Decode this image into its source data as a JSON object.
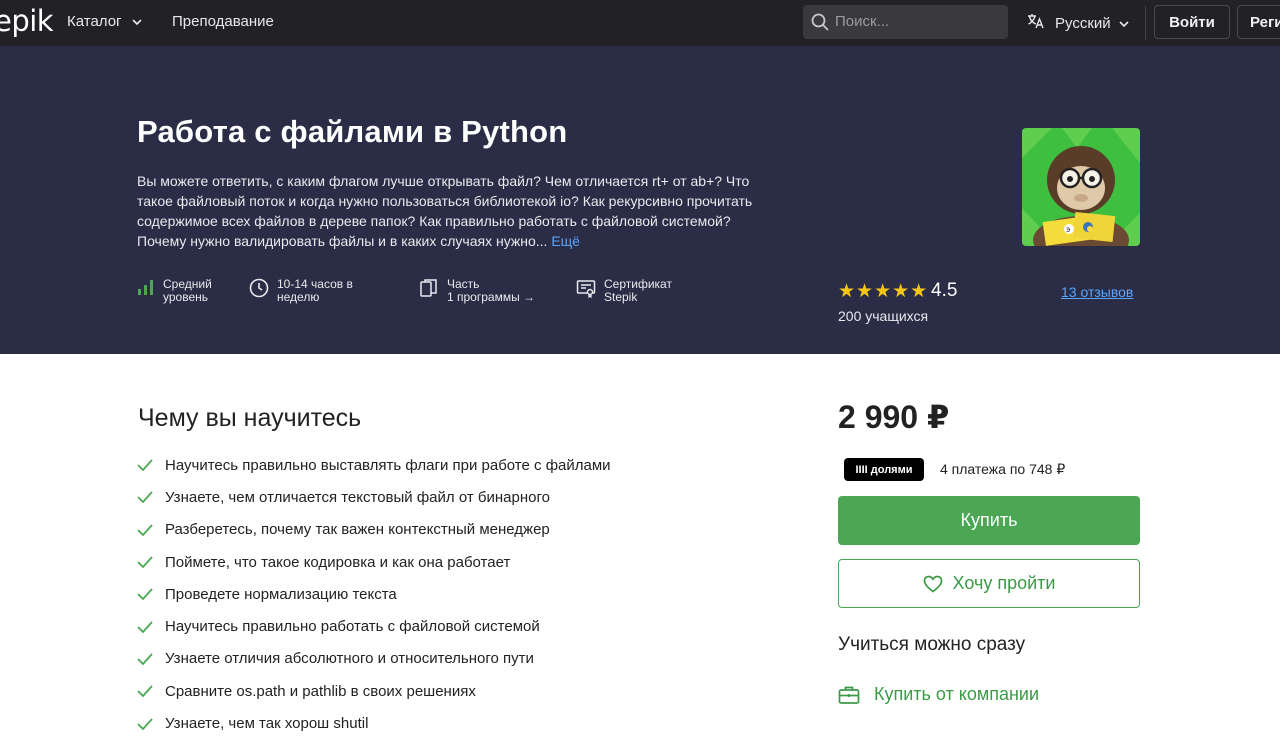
{
  "header": {
    "logo": "epik",
    "nav": [
      {
        "label": "Каталог",
        "has_dropdown": true
      },
      {
        "label": "Преподавание",
        "has_dropdown": false
      }
    ],
    "search_placeholder": "Поиск...",
    "language": "Русский",
    "login": "Войти",
    "register": "Реги"
  },
  "course": {
    "title": "Работа с файлами в Python",
    "description": "Вы можете ответить, с каким флагом лучше открывать файл? Чем отличается rt+ от ab+? Что такое файловый поток и когда нужно пользоваться библиотекой io? Как рекурсивно прочитать содержимое всех файлов в дереве папок? Как правильно работать с файловой системой? Почему нужно валидировать файлы и в каких случаях нужно...",
    "more_link": "Ещё",
    "meta": [
      {
        "icon": "level-bars-icon",
        "line1": "Средний",
        "line2": "уровень"
      },
      {
        "icon": "clock-icon",
        "line1": "10-14 часов в",
        "line2": "неделю"
      },
      {
        "icon": "programs-icon",
        "line1": "Часть",
        "line2": "1 программы →"
      },
      {
        "icon": "certificate-icon",
        "line1": "Сертификат",
        "line2": "Stepik"
      }
    ],
    "stars": "★★★★★",
    "rating": "4.5",
    "learners": "200 учащихся",
    "reviews": "13 отзывов"
  },
  "learn": {
    "heading": "Чему вы научитесь",
    "items": [
      "Научитесь правильно выставлять флаги при работе с файлами",
      "Узнаете, чем отличается текстовый файл от бинарного",
      "Разберетесь, почему так важен контекстный менеджер",
      "Поймете, что такое кодировка и как она работает",
      "Проведете нормализацию текста",
      "Научитесь правильно работать с файловой системой",
      "Узнаете отличия абсолютного и относительного пути",
      "Сравните os.path и pathlib в своих решениях",
      "Узнаете, чем так хорош shutil"
    ]
  },
  "purchase": {
    "price": "2 990 ₽",
    "dolyami_badge": "IIII долями",
    "installments": "4 платежа по 748 ₽",
    "buy": "Купить",
    "wishlist": "Хочу пройти",
    "learn_now": "Учиться можно сразу",
    "company": "Купить от компании"
  },
  "colors": {
    "topbar": "#222226",
    "hero": "#2b2c45",
    "accent_green": "#4ba754",
    "link_blue": "#5aa6ff",
    "star": "#f5c518"
  }
}
